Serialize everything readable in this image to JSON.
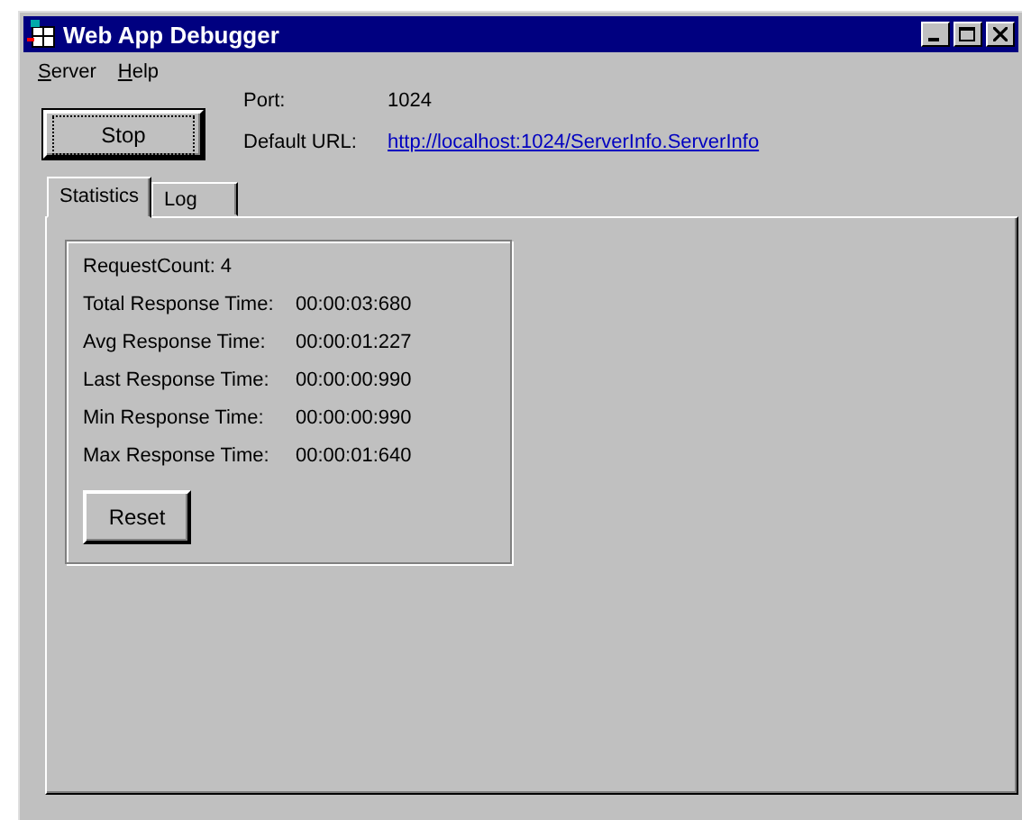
{
  "window": {
    "title": "Web App Debugger"
  },
  "menu": [
    {
      "label": "Server"
    },
    {
      "label": "Help"
    }
  ],
  "stop_button": "Stop",
  "port": {
    "label": "Port:",
    "value": "1024"
  },
  "default_url": {
    "label": "Default URL:",
    "value": "http://localhost:1024/ServerInfo.ServerInfo"
  },
  "tabs": [
    {
      "label": "Statistics",
      "selected": true
    },
    {
      "label": "Log",
      "selected": false
    }
  ],
  "statistics": {
    "request_count": "RequestCount: 4",
    "rows": [
      {
        "label": "Total Response Time:",
        "value": "00:00:03:680"
      },
      {
        "label": "Avg Response Time:",
        "value": "00:00:01:227"
      },
      {
        "label": "Last Response Time:",
        "value": "00:00:00:990"
      },
      {
        "label": "Min Response Time:",
        "value": "00:00:00:990"
      },
      {
        "label": "Max Response Time:",
        "value": "00:00:01:640"
      }
    ],
    "reset_button": "Reset"
  }
}
